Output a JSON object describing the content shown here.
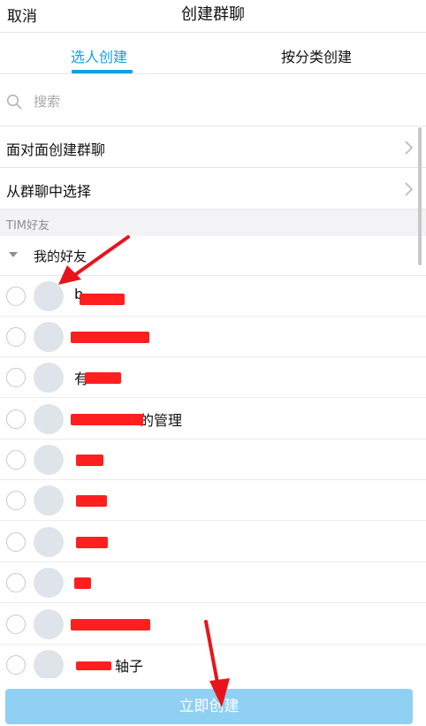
{
  "header": {
    "cancel_label": "取消",
    "title": "创建群聊"
  },
  "tabs": [
    {
      "label": "选人创建",
      "active": true
    },
    {
      "label": "按分类创建",
      "active": false
    }
  ],
  "search": {
    "placeholder": "搜索",
    "icon": "search-icon"
  },
  "menu": [
    {
      "label": "面对面创建群聊",
      "icon": "chevron-right-icon"
    },
    {
      "label": "从群聊中选择",
      "icon": "chevron-right-icon"
    }
  ],
  "section": {
    "label": "TIM好友"
  },
  "group": {
    "name": "我的好友",
    "icon": "caret-down-icon"
  },
  "friends": [
    {
      "name": "b",
      "redacted": true
    },
    {
      "name": "",
      "redacted": true
    },
    {
      "name": "有",
      "redacted": true
    },
    {
      "name": "的管理",
      "redacted": true
    },
    {
      "name": "",
      "redacted": true
    },
    {
      "name": "",
      "redacted": true
    },
    {
      "name": "",
      "redacted": true
    },
    {
      "name": "",
      "redacted": true
    },
    {
      "name": "",
      "redacted": true
    },
    {
      "name": "轴子",
      "redacted": true
    }
  ],
  "footer": {
    "create_label": "立即创建"
  },
  "colors": {
    "accent": "#12a0ea",
    "button": "#8fd0f3",
    "redaction": "#ff1f1f",
    "annotation_arrow": "#e8141b"
  }
}
